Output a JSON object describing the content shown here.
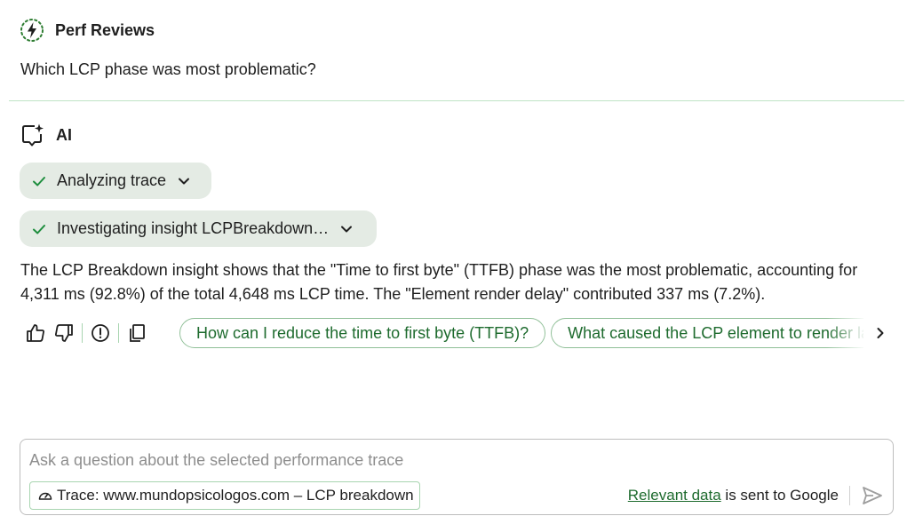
{
  "user": {
    "name": "Perf Reviews",
    "avatar_icon": "perf-lightning-icon"
  },
  "question": "Which LCP phase was most problematic?",
  "ai": {
    "name": "AI",
    "icon": "ai-chat-sparkle-icon"
  },
  "steps": [
    {
      "label": "Analyzing trace",
      "status": "done"
    },
    {
      "label": "Investigating insight LCPBreakdown…",
      "status": "done"
    }
  ],
  "answer": "The LCP Breakdown insight shows that the \"Time to first byte\" (TTFB) phase was the most problematic, accounting for 4,311 ms (92.8%) of the total 4,648 ms LCP time. The \"Element render delay\" contributed 337 ms (7.2%).",
  "suggestions": [
    "How can I reduce the time to first byte (TTFB)?",
    "What caused the LCP element to render late?"
  ],
  "input": {
    "placeholder": "Ask a question about the selected performance trace",
    "context_label": "Trace: www.mundopsicologos.com – LCP breakdown",
    "disclaimer_link": "Relevant data",
    "disclaimer_rest": " is sent to Google"
  },
  "colors": {
    "accent": "#1e6b2e",
    "check": "#1e8e3e",
    "divider": "#bfe3c6",
    "step_bg": "#e4ebe4"
  }
}
